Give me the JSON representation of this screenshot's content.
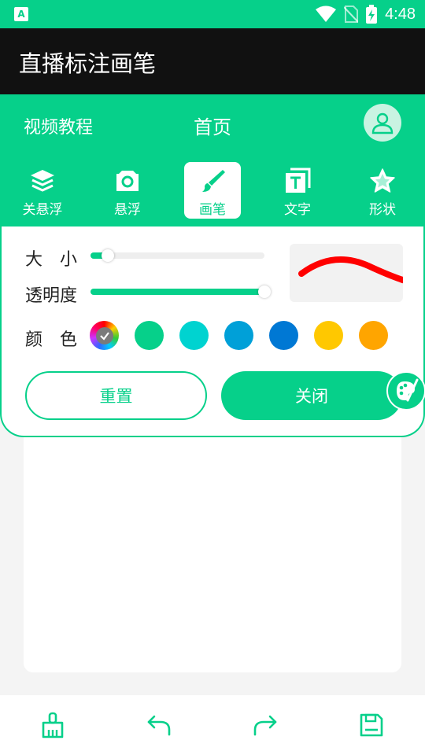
{
  "status_bar": {
    "time": "4:48",
    "app_glyph": "A"
  },
  "app_bar": {
    "title": "直播标注画笔"
  },
  "header": {
    "tutorial_label": "视频教程",
    "home_label": "首页"
  },
  "toolbar": {
    "items": [
      {
        "label": "关悬浮",
        "icon": "layers-icon",
        "active": false
      },
      {
        "label": "悬浮",
        "icon": "camera-icon",
        "active": false
      },
      {
        "label": "画笔",
        "icon": "brush-icon",
        "active": true
      },
      {
        "label": "文字",
        "icon": "text-icon",
        "active": false
      },
      {
        "label": "形状",
        "icon": "star-icon",
        "active": false
      }
    ]
  },
  "brush_panel": {
    "size_label": "大　小",
    "opacity_label": "透明度",
    "color_label": "颜　色",
    "size_value": 0.1,
    "opacity_value": 1.0,
    "preview_color": "#ff0000",
    "colors": [
      "#06d08a",
      "#00d3d0",
      "#00a0d8",
      "#0078d4",
      "#ffc800",
      "#ffa500"
    ],
    "reset_label": "重置",
    "close_label": "关闭"
  },
  "theme": {
    "accent": "#06d08a",
    "app_bar_bg": "#111111"
  }
}
